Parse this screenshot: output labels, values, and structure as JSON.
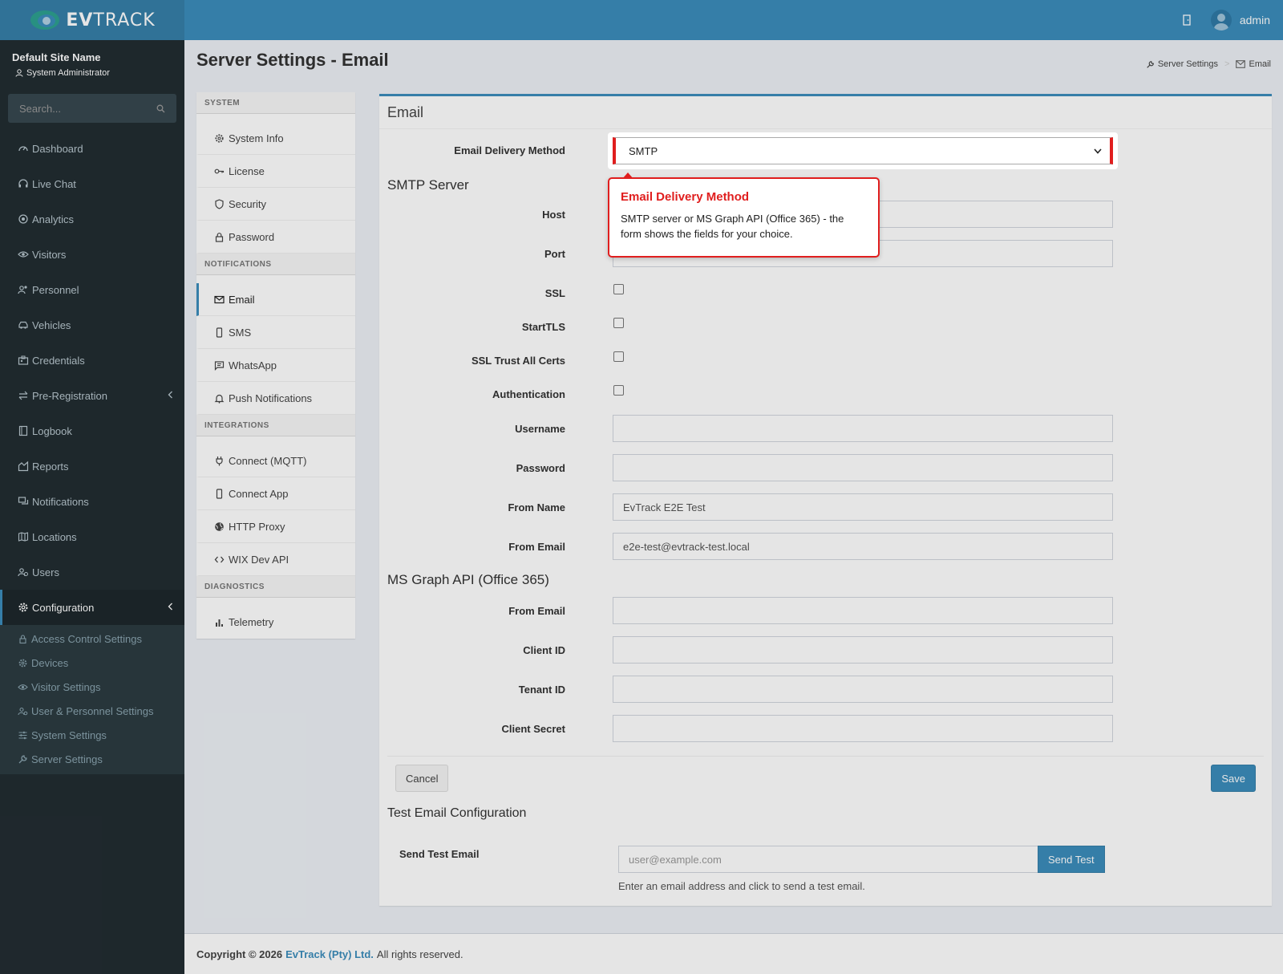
{
  "brand": {
    "name_bold": "EV",
    "name_rest": "TRACK"
  },
  "header": {
    "user": "admin"
  },
  "sidebar": {
    "site_name": "Default Site Name",
    "role": "System Administrator",
    "search_placeholder": "Search...",
    "items": [
      {
        "label": "Dashboard",
        "icon": "dashboard-icon"
      },
      {
        "label": "Live Chat",
        "icon": "headset-icon"
      },
      {
        "label": "Analytics",
        "icon": "target-icon"
      },
      {
        "label": "Visitors",
        "icon": "eye-icon"
      },
      {
        "label": "Personnel",
        "icon": "user-group-icon"
      },
      {
        "label": "Vehicles",
        "icon": "car-icon"
      },
      {
        "label": "Credentials",
        "icon": "id-card-icon"
      },
      {
        "label": "Pre-Registration",
        "icon": "swap-icon"
      },
      {
        "label": "Logbook",
        "icon": "book-icon"
      },
      {
        "label": "Reports",
        "icon": "chart-icon"
      },
      {
        "label": "Notifications",
        "icon": "chat-icon"
      },
      {
        "label": "Locations",
        "icon": "map-icon"
      },
      {
        "label": "Users",
        "icon": "users-icon"
      },
      {
        "label": "Configuration",
        "icon": "gear-icon"
      }
    ],
    "config_submenu": [
      {
        "label": "Access Control Settings"
      },
      {
        "label": "Devices"
      },
      {
        "label": "Visitor Settings"
      },
      {
        "label": "User & Personnel Settings"
      },
      {
        "label": "System Settings"
      },
      {
        "label": "Server Settings"
      }
    ]
  },
  "page": {
    "title": "Server Settings - Email",
    "breadcrumb": [
      "Server Settings",
      "Email"
    ]
  },
  "settings_nav": {
    "sections": [
      {
        "title": "SYSTEM",
        "items": [
          "System Info",
          "License",
          "Security",
          "Password"
        ]
      },
      {
        "title": "NOTIFICATIONS",
        "items": [
          "Email",
          "SMS",
          "WhatsApp",
          "Push Notifications"
        ]
      },
      {
        "title": "INTEGRATIONS",
        "items": [
          "Connect (MQTT)",
          "Connect App",
          "HTTP Proxy",
          "WIX Dev API"
        ]
      },
      {
        "title": "DIAGNOSTICS",
        "items": [
          "Telemetry"
        ]
      }
    ]
  },
  "form": {
    "box_title": "Email",
    "delivery_method_label": "Email Delivery Method",
    "delivery_method_value": "SMTP",
    "smtp_heading": "SMTP Server",
    "host_label": "Host",
    "port_label": "Port",
    "ssl_label": "SSL",
    "starttls_label": "StartTLS",
    "ssl_trust_label": "SSL Trust All Certs",
    "auth_label": "Authentication",
    "username_label": "Username",
    "password_label": "Password",
    "from_name_label": "From Name",
    "from_name_value": "EvTrack E2E Test",
    "from_email_label": "From Email",
    "from_email_value": "e2e-test@evtrack-test.local",
    "msgraph_heading": "MS Graph API (Office 365)",
    "ms_from_email_label": "From Email",
    "client_id_label": "Client ID",
    "tenant_id_label": "Tenant ID",
    "client_secret_label": "Client Secret",
    "cancel_label": "Cancel",
    "save_label": "Save",
    "test_heading": "Test Email Configuration",
    "send_test_label": "Send Test Email",
    "test_placeholder": "user@example.com",
    "send_test_button": "Send Test",
    "test_help": "Enter an email address and click to send a test email."
  },
  "tooltip": {
    "title": "Email Delivery Method",
    "text": "SMTP server or MS Graph API (Office 365) - the form shows the fields for your choice."
  },
  "footer": {
    "prefix": "Copyright © 2026",
    "company": "EvTrack (Pty) Ltd.",
    "suffix": "All rights reserved."
  },
  "colors": {
    "primary": "#3c8dbc",
    "sidebar": "#222d32",
    "highlight": "#e01e1e"
  }
}
